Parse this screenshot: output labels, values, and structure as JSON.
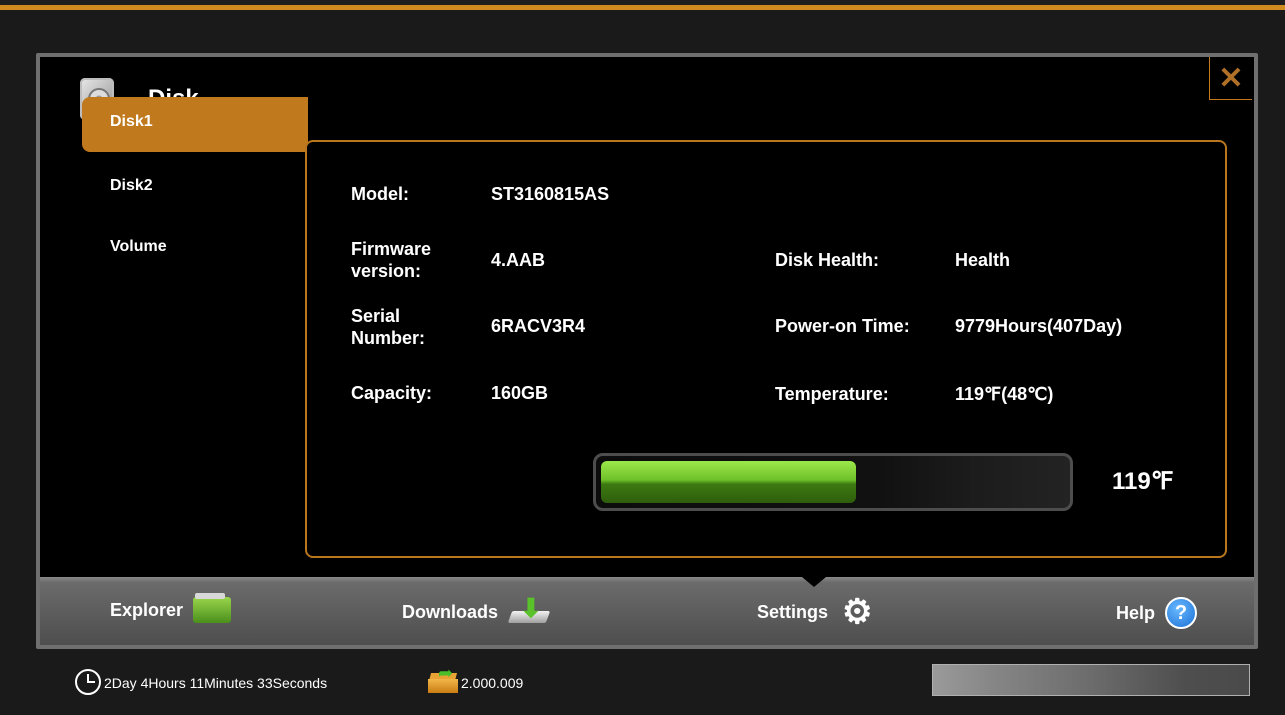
{
  "window": {
    "title": "Disk",
    "close_label": "✕"
  },
  "sidebar": {
    "items": [
      {
        "label": "Disk1",
        "active": true
      },
      {
        "label": "Disk2",
        "active": false
      },
      {
        "label": "Volume",
        "active": false
      }
    ]
  },
  "disk_info": {
    "model_label": "Model:",
    "model_value": "ST3160815AS",
    "firmware_label_line1": "Firmware",
    "firmware_label_line2": "version:",
    "firmware_value": "4.AAB",
    "serial_label_line1": "Serial",
    "serial_label_line2": "Number:",
    "serial_value": "6RACV3R4",
    "capacity_label": "Capacity:",
    "capacity_value": "160GB",
    "health_label": "Disk Health:",
    "health_value": "Health",
    "power_on_label": "Power-on Time:",
    "power_on_value": "9779Hours(407Day)",
    "temperature_label": "Temperature:",
    "temperature_value": "119℉(48℃)"
  },
  "temperature_gauge": {
    "level_fraction": 0.55,
    "readout": "119℉"
  },
  "tabs": [
    {
      "label": "Explorer",
      "icon": "folder-icon"
    },
    {
      "label": "Downloads",
      "icon": "download-icon"
    },
    {
      "label": "Settings",
      "icon": "gear-icon",
      "active": true
    },
    {
      "label": "Help",
      "icon": "help-icon",
      "glyph": "?"
    }
  ],
  "status": {
    "uptime": "2Day 4Hours 11Minutes 33Seconds",
    "version": "2.000.009"
  },
  "colors": {
    "accent": "#c0791c",
    "gauge_green": "#6fc12a"
  }
}
